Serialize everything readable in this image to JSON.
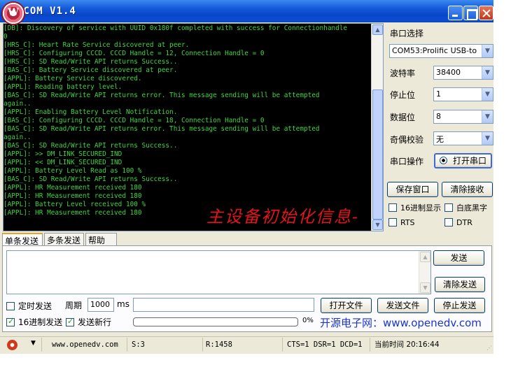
{
  "window": {
    "title": "XCOM V1.4",
    "logo_letter": "W"
  },
  "terminal": {
    "lines": [
      "[DB]: Discovery of service with UUID 0x180f completed with success for Connectionhandle",
      "0",
      "[HRS_C]: Heart Rate Service discovered at peer.",
      "[HRS_C]: Configuring CCCD. CCCD Handle = 12, Connection Handle = 0",
      "[HRS_C]: SD Read/Write API returns Success..",
      "[BAS_C]: Battery Service discovered at peer.",
      "[APPL]: Battery Service discovered.",
      "[APPL]: Reading battery level.",
      "[BAS_C]: SD Read/Write API returns error. This message sending will be attempted",
      "again..",
      "[APPL]: Enabling Battery Level Notification.",
      "[BAS_C]: Configuring CCCD. CCCD Handle = 18, Connection Handle = 0",
      "[BAS_C]: SD Read/Write API returns error. This message sending will be attempted",
      "again..",
      "[BAS_C]: SD Read/Write API returns Success..",
      "[APPL]: >> DM_LINK_SECURED_IND",
      "[APPL]: << DM_LINK_SECURED_IND",
      "[APPL]: Battery Level Read as 100 %",
      "[BAS_C]: SD Read/Write API returns Success..",
      "[APPL]: HR Measurement received 180",
      "[APPL]: HR Measurement received 180",
      "[APPL]: Battery Level received 100 %",
      "[APPL]: HR Measurement received 180"
    ],
    "overlay_text": "主设备初始化信息-"
  },
  "settings": {
    "port_label": "串口选择",
    "port_value": "COM53:Prolific USB-to",
    "baud_label": "波特率",
    "baud_value": "38400",
    "stopbits_label": "停止位",
    "stopbits_value": "1",
    "databits_label": "数据位",
    "databits_value": "8",
    "parity_label": "奇偶校验",
    "parity_value": "无",
    "operation_label": "串口操作",
    "open_port_button": "打开串口",
    "save_window_button": "保存窗口",
    "clear_receive_button": "清除接收",
    "hex_display_label": "16进制显示",
    "white_bg_label": "白底黑字",
    "rts_label": "RTS",
    "dtr_label": "DTR"
  },
  "tabs": [
    "单条发送",
    "多条发送",
    "帮助"
  ],
  "send": {
    "send_button": "发送",
    "clear_send_button": "清除发送",
    "timed_send_label": "定时发送",
    "period_label": "周期",
    "period_value": "1000",
    "period_unit": "ms",
    "open_file_button": "打开文件",
    "send_file_button": "发送文件",
    "stop_send_button": "停止发送",
    "hex_send_label": "16进制发送",
    "hex_send_checked": true,
    "newline_label": "发送新行",
    "newline_checked": true,
    "progress_percent": "0%",
    "promo_text": "开源电子网：www.openedv.com"
  },
  "status": {
    "url": "www.openedv.com",
    "sent": "S:3",
    "received": "R:1458",
    "lines": "CTS=1 DSR=1 DCD=1",
    "time": "当前时间 20:16:44"
  }
}
